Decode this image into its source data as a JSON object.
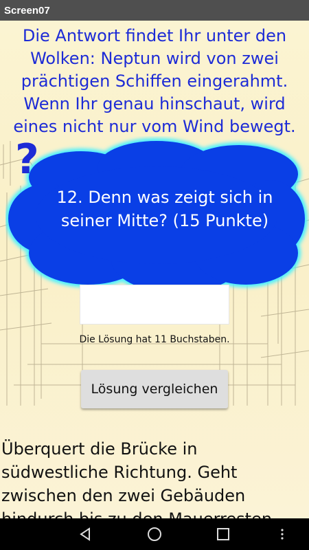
{
  "app": {
    "title": "Screen07"
  },
  "main": {
    "intro": "Die Antwort findet Ihr unter den Wolken: Neptun wird von zwei prächtigen Schiffen eingerahmt. Wenn Ihr genau hinschaut, wird eines nicht nur vom Wind bewegt.",
    "question_mark": "?",
    "question": "12. Denn was zeigt sich in seiner Mitte? (15 Punkte)",
    "answer": {
      "value": "",
      "placeholder": ""
    },
    "hint": "Die Lösung hat 11 Buchstaben.",
    "compare_label": "Lösung vergleichen",
    "directions": "Überquert die Brücke in südwestliche Richtung. Geht zwischen den zwei Gebäuden hindurch bis zu den Mauerresten"
  },
  "navbar": {
    "back_icon": "back-triangle-icon",
    "home_icon": "home-circle-icon",
    "recents_icon": "recents-square-icon",
    "menu_icon": "overflow-menu-icon"
  },
  "colors": {
    "intro_text": "#1d2bd6",
    "cloud_fill": "#0a3fe6",
    "cloud_glow": "#47f0ff",
    "background": "#fbf4d6",
    "titlebar": "#4f4f4f"
  }
}
